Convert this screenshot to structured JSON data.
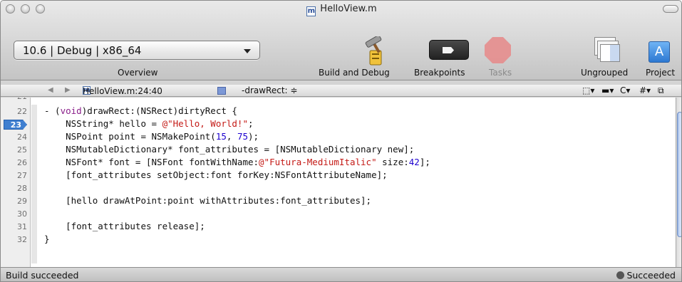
{
  "window": {
    "title": "HelloView.m",
    "file_badge": "m"
  },
  "toolbar": {
    "config_value": "10.6 | Debug | x86_64",
    "overview_label": "Overview",
    "build_debug_label": "Build and Debug",
    "breakpoints_label": "Breakpoints",
    "tasks_label": "Tasks",
    "ungrouped_label": "Ungrouped",
    "project_label": "Project"
  },
  "navbar": {
    "back_arrow": "◀",
    "forward_arrow": "▶",
    "file_badge": "m",
    "file_location": "HelloView.m:24:40 ≑",
    "method_label": "-drawRect: ≑",
    "right_tools": [
      "⬚▾",
      "▬▾",
      "C▾",
      "#▾",
      "⧉"
    ]
  },
  "editor": {
    "top_partial_line": "21",
    "lines": [
      {
        "n": "22",
        "text": "- (void)drawRect:(NSRect)dirtyRect {"
      },
      {
        "n": "23",
        "text": "    NSString* hello = @\"Hello, World!\";",
        "breakpoint": true
      },
      {
        "n": "24",
        "text": "    NSPoint point = NSMakePoint(15, 75);"
      },
      {
        "n": "25",
        "text": "    NSMutableDictionary* font_attributes = [NSMutableDictionary new];"
      },
      {
        "n": "26",
        "text": "    NSFont* font = [NSFont fontWithName:@\"Futura-MediumItalic\" size:42];"
      },
      {
        "n": "27",
        "text": "    [font_attributes setObject:font forKey:NSFontAttributeName];"
      },
      {
        "n": "28",
        "text": ""
      },
      {
        "n": "29",
        "text": "    [hello drawAtPoint:point withAttributes:font_attributes];"
      },
      {
        "n": "30",
        "text": ""
      },
      {
        "n": "31",
        "text": "    [font_attributes release];"
      },
      {
        "n": "32",
        "text": "}"
      }
    ]
  },
  "status": {
    "left_text": "Build succeeded",
    "right_text": "Succeeded"
  },
  "colors": {
    "keyword": "#8a1e8a",
    "string": "#c41a16",
    "number": "#1c00cf",
    "breakpoint": "#3f7fd0"
  }
}
